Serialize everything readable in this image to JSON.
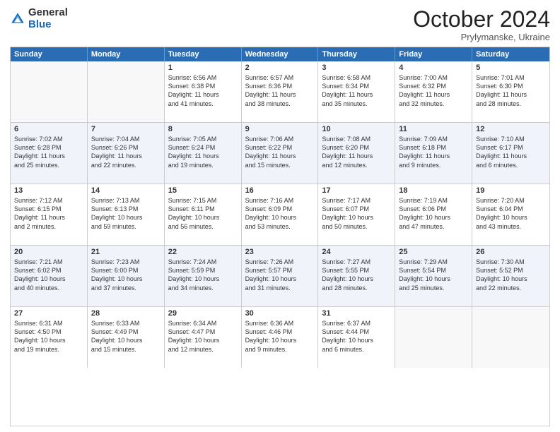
{
  "logo": {
    "general": "General",
    "blue": "Blue"
  },
  "header": {
    "month": "October 2024",
    "location": "Prylymanske, Ukraine"
  },
  "weekdays": [
    "Sunday",
    "Monday",
    "Tuesday",
    "Wednesday",
    "Thursday",
    "Friday",
    "Saturday"
  ],
  "weeks": [
    [
      {
        "day": "",
        "empty": true,
        "lines": []
      },
      {
        "day": "",
        "empty": true,
        "lines": []
      },
      {
        "day": "1",
        "empty": false,
        "lines": [
          "Sunrise: 6:56 AM",
          "Sunset: 6:38 PM",
          "Daylight: 11 hours",
          "and 41 minutes."
        ]
      },
      {
        "day": "2",
        "empty": false,
        "lines": [
          "Sunrise: 6:57 AM",
          "Sunset: 6:36 PM",
          "Daylight: 11 hours",
          "and 38 minutes."
        ]
      },
      {
        "day": "3",
        "empty": false,
        "lines": [
          "Sunrise: 6:58 AM",
          "Sunset: 6:34 PM",
          "Daylight: 11 hours",
          "and 35 minutes."
        ]
      },
      {
        "day": "4",
        "empty": false,
        "lines": [
          "Sunrise: 7:00 AM",
          "Sunset: 6:32 PM",
          "Daylight: 11 hours",
          "and 32 minutes."
        ]
      },
      {
        "day": "5",
        "empty": false,
        "lines": [
          "Sunrise: 7:01 AM",
          "Sunset: 6:30 PM",
          "Daylight: 11 hours",
          "and 28 minutes."
        ]
      }
    ],
    [
      {
        "day": "6",
        "empty": false,
        "lines": [
          "Sunrise: 7:02 AM",
          "Sunset: 6:28 PM",
          "Daylight: 11 hours",
          "and 25 minutes."
        ]
      },
      {
        "day": "7",
        "empty": false,
        "lines": [
          "Sunrise: 7:04 AM",
          "Sunset: 6:26 PM",
          "Daylight: 11 hours",
          "and 22 minutes."
        ]
      },
      {
        "day": "8",
        "empty": false,
        "lines": [
          "Sunrise: 7:05 AM",
          "Sunset: 6:24 PM",
          "Daylight: 11 hours",
          "and 19 minutes."
        ]
      },
      {
        "day": "9",
        "empty": false,
        "lines": [
          "Sunrise: 7:06 AM",
          "Sunset: 6:22 PM",
          "Daylight: 11 hours",
          "and 15 minutes."
        ]
      },
      {
        "day": "10",
        "empty": false,
        "lines": [
          "Sunrise: 7:08 AM",
          "Sunset: 6:20 PM",
          "Daylight: 11 hours",
          "and 12 minutes."
        ]
      },
      {
        "day": "11",
        "empty": false,
        "lines": [
          "Sunrise: 7:09 AM",
          "Sunset: 6:18 PM",
          "Daylight: 11 hours",
          "and 9 minutes."
        ]
      },
      {
        "day": "12",
        "empty": false,
        "lines": [
          "Sunrise: 7:10 AM",
          "Sunset: 6:17 PM",
          "Daylight: 11 hours",
          "and 6 minutes."
        ]
      }
    ],
    [
      {
        "day": "13",
        "empty": false,
        "lines": [
          "Sunrise: 7:12 AM",
          "Sunset: 6:15 PM",
          "Daylight: 11 hours",
          "and 2 minutes."
        ]
      },
      {
        "day": "14",
        "empty": false,
        "lines": [
          "Sunrise: 7:13 AM",
          "Sunset: 6:13 PM",
          "Daylight: 10 hours",
          "and 59 minutes."
        ]
      },
      {
        "day": "15",
        "empty": false,
        "lines": [
          "Sunrise: 7:15 AM",
          "Sunset: 6:11 PM",
          "Daylight: 10 hours",
          "and 56 minutes."
        ]
      },
      {
        "day": "16",
        "empty": false,
        "lines": [
          "Sunrise: 7:16 AM",
          "Sunset: 6:09 PM",
          "Daylight: 10 hours",
          "and 53 minutes."
        ]
      },
      {
        "day": "17",
        "empty": false,
        "lines": [
          "Sunrise: 7:17 AM",
          "Sunset: 6:07 PM",
          "Daylight: 10 hours",
          "and 50 minutes."
        ]
      },
      {
        "day": "18",
        "empty": false,
        "lines": [
          "Sunrise: 7:19 AM",
          "Sunset: 6:06 PM",
          "Daylight: 10 hours",
          "and 47 minutes."
        ]
      },
      {
        "day": "19",
        "empty": false,
        "lines": [
          "Sunrise: 7:20 AM",
          "Sunset: 6:04 PM",
          "Daylight: 10 hours",
          "and 43 minutes."
        ]
      }
    ],
    [
      {
        "day": "20",
        "empty": false,
        "lines": [
          "Sunrise: 7:21 AM",
          "Sunset: 6:02 PM",
          "Daylight: 10 hours",
          "and 40 minutes."
        ]
      },
      {
        "day": "21",
        "empty": false,
        "lines": [
          "Sunrise: 7:23 AM",
          "Sunset: 6:00 PM",
          "Daylight: 10 hours",
          "and 37 minutes."
        ]
      },
      {
        "day": "22",
        "empty": false,
        "lines": [
          "Sunrise: 7:24 AM",
          "Sunset: 5:59 PM",
          "Daylight: 10 hours",
          "and 34 minutes."
        ]
      },
      {
        "day": "23",
        "empty": false,
        "lines": [
          "Sunrise: 7:26 AM",
          "Sunset: 5:57 PM",
          "Daylight: 10 hours",
          "and 31 minutes."
        ]
      },
      {
        "day": "24",
        "empty": false,
        "lines": [
          "Sunrise: 7:27 AM",
          "Sunset: 5:55 PM",
          "Daylight: 10 hours",
          "and 28 minutes."
        ]
      },
      {
        "day": "25",
        "empty": false,
        "lines": [
          "Sunrise: 7:29 AM",
          "Sunset: 5:54 PM",
          "Daylight: 10 hours",
          "and 25 minutes."
        ]
      },
      {
        "day": "26",
        "empty": false,
        "lines": [
          "Sunrise: 7:30 AM",
          "Sunset: 5:52 PM",
          "Daylight: 10 hours",
          "and 22 minutes."
        ]
      }
    ],
    [
      {
        "day": "27",
        "empty": false,
        "lines": [
          "Sunrise: 6:31 AM",
          "Sunset: 4:50 PM",
          "Daylight: 10 hours",
          "and 19 minutes."
        ]
      },
      {
        "day": "28",
        "empty": false,
        "lines": [
          "Sunrise: 6:33 AM",
          "Sunset: 4:49 PM",
          "Daylight: 10 hours",
          "and 15 minutes."
        ]
      },
      {
        "day": "29",
        "empty": false,
        "lines": [
          "Sunrise: 6:34 AM",
          "Sunset: 4:47 PM",
          "Daylight: 10 hours",
          "and 12 minutes."
        ]
      },
      {
        "day": "30",
        "empty": false,
        "lines": [
          "Sunrise: 6:36 AM",
          "Sunset: 4:46 PM",
          "Daylight: 10 hours",
          "and 9 minutes."
        ]
      },
      {
        "day": "31",
        "empty": false,
        "lines": [
          "Sunrise: 6:37 AM",
          "Sunset: 4:44 PM",
          "Daylight: 10 hours",
          "and 6 minutes."
        ]
      },
      {
        "day": "",
        "empty": true,
        "lines": []
      },
      {
        "day": "",
        "empty": true,
        "lines": []
      }
    ]
  ]
}
